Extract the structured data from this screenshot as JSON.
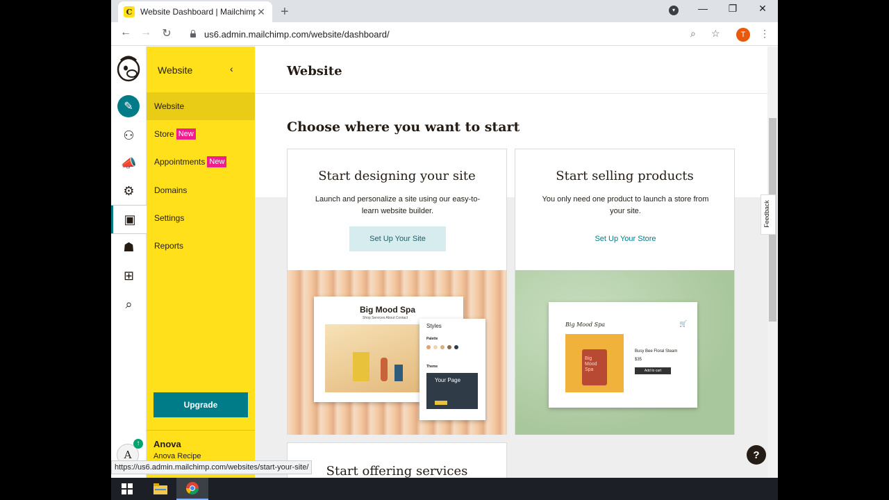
{
  "browser": {
    "tab_title": "Website Dashboard | Mailchimp",
    "favicon_letter": "C",
    "url": "us6.admin.mailchimp.com/website/dashboard/",
    "profile_initial": "T",
    "status_url": "https://us6.admin.mailchimp.com/websites/start-your-site/"
  },
  "sidebar": {
    "title": "Website",
    "items": [
      {
        "label": "Website"
      },
      {
        "label": "Store",
        "badge": "New"
      },
      {
        "label": "Appointments",
        "badge": "New"
      },
      {
        "label": "Domains"
      },
      {
        "label": "Settings"
      },
      {
        "label": "Reports"
      }
    ],
    "upgrade_label": "Upgrade",
    "account_name": "Anova",
    "account_sub": "Anova Recipe",
    "account_initial": "A"
  },
  "main": {
    "page_title": "Website",
    "section_title": "Choose where you want to start",
    "cards": [
      {
        "title": "Start designing your site",
        "desc": "Launch and personalize a site using our easy-to-learn website builder.",
        "cta": "Set Up Your Site",
        "mock_title": "Big Mood Spa",
        "mock_nav": "Shop   Services   About   Contact",
        "styles_label": "Styles",
        "palette_label": "Palette",
        "theme_label": "Theme",
        "panel_title": "Your Page"
      },
      {
        "title": "Start selling products",
        "desc": "You only need one product to launch a store from your site.",
        "cta": "Set Up Your Store",
        "mock_title": "Big Mood Spa",
        "product_name": "Busy Bee Floral Steam",
        "product_price": "$35",
        "add_to_cart": "Add to cart",
        "jar_label": "Big Mood Spa"
      }
    ],
    "third_card_title": "Start offering services"
  },
  "feedback_label": "Feedback",
  "help_label": "?"
}
